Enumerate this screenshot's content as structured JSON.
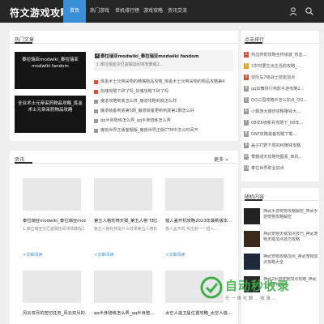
{
  "header": {
    "logo": "符文游戏攻略网",
    "nav": [
      "首页",
      "热门游戏",
      "单机排行榜",
      "游戏攻略",
      "资讯交流"
    ],
    "active_index": 0,
    "icons": [
      "user-icon",
      "search-icon"
    ],
    "colors": {
      "bar": "#262626",
      "active": "#3a8fd9"
    }
  },
  "hot": {
    "heading": "热门文章",
    "featured": [
      {
        "title": "泰拉瑞亚modwiki_泰拉瑞亚modwiki fandom"
      },
      {
        "title": "全业术士元帝采药物品攻略_炼金术士元帝采药物品攻略"
      }
    ],
    "highlight": {
      "num": "1",
      "title": "泰拉瑞亚modwiki_泰拉瑞亚modwiki fandom",
      "desc": "1.泰拉瑞亚灾厄盗贼指间将软教程2..."
    },
    "list": [
      {
        "num": "2",
        "title": "炼金术士元帝采物的精嘴物品攻略_炼金术士元帝采物的物品攻略第4"
      },
      {
        "num": "3",
        "title": "剑魂攻略下碎了吗_剑魂攻略下碎了吗"
      },
      {
        "num": "4",
        "title": "魔道攻略到底怎么样_魔道攻略到底怎么样"
      },
      {
        "num": "5",
        "title": "魔道装备到底第5期_魔道装备更新到底第2期怎么好"
      },
      {
        "num": "6",
        "title": "qq半身陪练怎么弄_qq半身陪练怎么弄"
      },
      {
        "num": "7",
        "title": "魔兽世界正版客棚版_魔兽世界正版CTM中怎么时间开"
      }
    ]
  },
  "news": {
    "heading": "资讯",
    "more": "更多",
    "cards": [
      {
        "title": "泰拉瑞亚modwiki_泰拉瑞亚mod...",
        "desc": "1.泰拉瑞亚灾厄盗贼指间将软教程2...",
        "tag": "+文章阅读"
      },
      {
        "title": "第五人格轮椅天赋_第五人格飞轮效...",
        "desc": "第五人格轮椅是什么效果第五人格轮椅...",
        "tag": "+文章阅读"
      },
      {
        "title": "猎人盖开机攻略2023年最新版本...",
        "desc": "猎人盖开机 攻击前一一猎人...",
        "tag": "+文章阅读"
      }
    ],
    "cards2": [
      {
        "title": "风云双月的密切任务_风云双月的..."
      },
      {
        "title": "qq半身陪练怎么弄_qq半身陪..."
      },
      {
        "title": "太空人造卫星位置攻略_太空人造..."
      }
    ]
  },
  "rank": {
    "heading": "点击排行",
    "items": [
      {
        "num": "1",
        "title": "热血传奇攻略全终级装_热血..."
      },
      {
        "num": "2",
        "title": "3岁时要生出生活的攻略_..."
      },
      {
        "num": "3",
        "title": "冒险岛7级战士技能加点"
      },
      {
        "num": "4",
        "title": "qq炫舞排行电影手游攻略2..."
      },
      {
        "num": "5",
        "title": "QQ三国攻略中怎么加点_QQ..."
      },
      {
        "num": "6",
        "title": "小霸游大爆炸攻略赚钱大..."
      },
      {
        "num": "7",
        "title": "08年6级新兵攻略下_08年..."
      },
      {
        "num": "8",
        "title": "DNF攻略装备攻略下载..."
      },
      {
        "num": "9",
        "title": "盖子打野下局如何赚钱攻略"
      },
      {
        "num": "10",
        "title": "攀霸成天攻略地图素_单机..."
      },
      {
        "num": "11",
        "title": "泰拉世界职业加点"
      }
    ]
  },
  "random": {
    "heading": "随机内容",
    "items": [
      {
        "title": "神武手游宠物攻略解密_神武手游宠物攻略解密"
      },
      {
        "title": "神武宠物天赋加点技巧_神武宠物天赋加点技巧攻略"
      },
      {
        "title": "神武宠物攻略加点_神武宠物加点攻略大全"
      },
      {
        "title": "神武2手游宠物加点攻略_神武手游宠物加点"
      }
    ]
  },
  "watermark": {
    "title": "自动秒收录",
    "subtitle": "乐 一 体 化 数 ... 收 录 ..."
  }
}
